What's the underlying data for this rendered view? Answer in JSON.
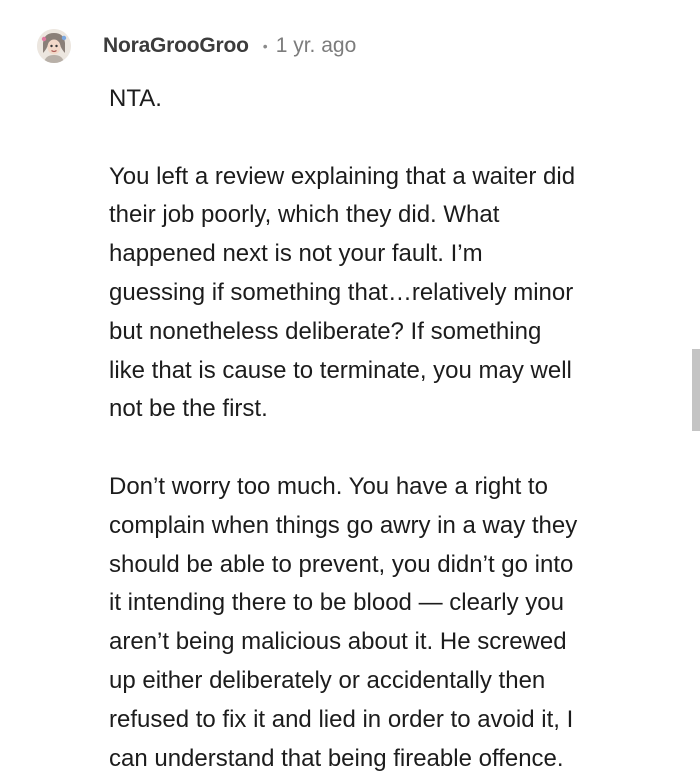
{
  "comment": {
    "username": "NoraGrooGroo",
    "separator": "•",
    "timestamp": "1 yr. ago",
    "avatar_icon": "user-avatar-icon",
    "paragraphs": [
      [
        "NTA."
      ],
      [
        "You left a review explaining that a waiter did",
        "their job poorly, which they did. What",
        "happened next is not your fault. I’m",
        "guessing if something that…relatively minor",
        "but nonetheless deliberate? If something",
        "like that is cause to terminate, you may well",
        "not be the first."
      ],
      [
        "Don’t worry too much. You have a right to",
        "complain when things go awry in a way they",
        "should be able to prevent, you didn’t go into",
        "it intending there to be blood — clearly you",
        "aren’t being malicious about it. He screwed",
        "up either deliberately or accidentally then",
        "refused to fix it and lied in order to avoid it, I",
        "can understand that being fireable offence."
      ]
    ]
  },
  "colors": {
    "username": "#3c3c3c",
    "timestamp": "#7c7c7c",
    "body_text": "#1c1c1c",
    "scrollbar": "#c4c4c4"
  }
}
